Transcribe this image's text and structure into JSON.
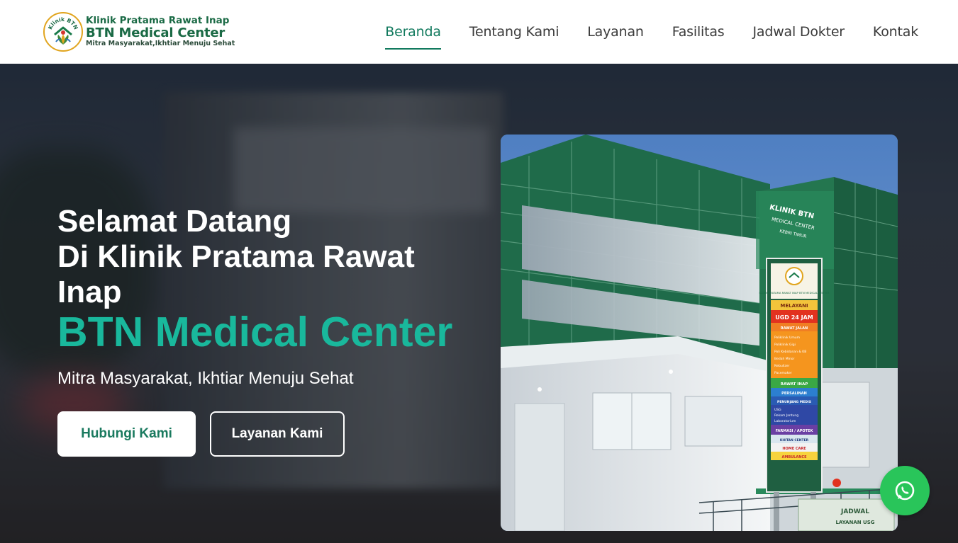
{
  "header": {
    "logo": {
      "badge_text": "Klinik BTN",
      "line1": "Klinik Pratama Rawat Inap",
      "line2": "BTN Medical Center",
      "line3": "Mitra Masyarakat,Ikhtiar Menuju Sehat"
    },
    "nav": [
      {
        "label": "Beranda",
        "active": true
      },
      {
        "label": "Tentang Kami",
        "active": false
      },
      {
        "label": "Layanan",
        "active": false
      },
      {
        "label": "Fasilitas",
        "active": false
      },
      {
        "label": "Jadwal Dokter",
        "active": false
      },
      {
        "label": "Kontak",
        "active": false
      }
    ]
  },
  "hero": {
    "title_line1": "Selamat Datang",
    "title_line2": "Di Klinik Pratama Rawat Inap",
    "brand": "BTN Medical Center",
    "subtitle": "Mitra Masyarakat, Ikhtiar Menuju Sehat",
    "primary_button": "Hubungi Kami",
    "secondary_button": "Layanan Kami"
  },
  "photo": {
    "sign_text": [
      "KLINIK BTN",
      "MEDICAL CENTER",
      "KEBRI TIMUR"
    ],
    "pylon": {
      "header": "KLINIK PRATAMA RAWAT INAP BTN MEDICAL CENTER",
      "melayani": "MELAYANI",
      "ugd": "UGD 24 JAM",
      "rawat_jalan": "RAWAT JALAN",
      "services_a": [
        "Poliklinik Umum",
        "Poliklinik Gigi",
        "Poli Kebidanan & KB",
        "Bedah Minor",
        "Nebulizer",
        "Pacemaker"
      ],
      "rawat_inap": "RAWAT INAP",
      "persalinan": "PERSALINAN",
      "penunjang": "PENUNJANG MEDIS",
      "services_b": [
        "USG",
        "Rekam Jantung",
        "Laboratorium"
      ],
      "farmasi": "FARMASI / APOTEK",
      "khitan": "KHITAN CENTER",
      "homecare": "HOME CARE",
      "ambulance": "AMBULANCE"
    },
    "banner": [
      "JADWAL",
      "LAYANAN USG"
    ]
  },
  "colors": {
    "brand_green": "#127a5e",
    "accent_teal": "#19b89c",
    "whatsapp": "#29c55a"
  },
  "icons": {
    "whatsapp": "whatsapp-icon",
    "logo": "clinic-logo-icon"
  }
}
